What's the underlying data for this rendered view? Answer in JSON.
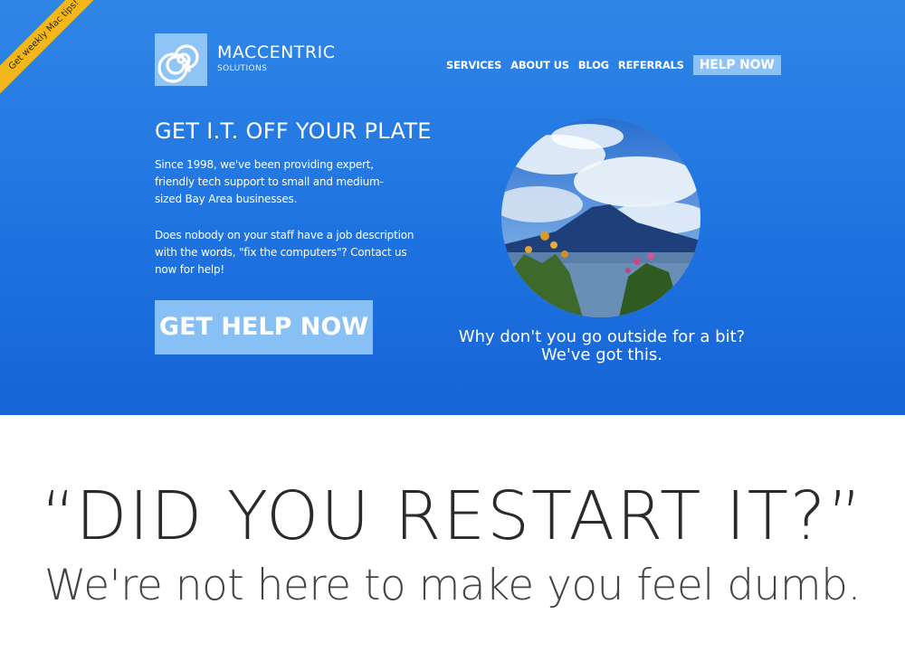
{
  "ribbon": {
    "label": "Get weekly Mac tips!"
  },
  "brand": {
    "name": "MACCENTRIC",
    "sub": "SOLUTIONS",
    "logo_icon": "spiral-icon",
    "logo_color": "#8fc4f6"
  },
  "nav": {
    "items": [
      {
        "label": "SERVICES"
      },
      {
        "label": "ABOUT US"
      },
      {
        "label": "BLOG"
      },
      {
        "label": "REFERRALS"
      },
      {
        "label": "HELP NOW"
      }
    ]
  },
  "hero": {
    "headline": "GET I.T. OFF YOUR PLATE",
    "paragraph1": "Since 1998, we've been providing expert, friendly tech support to small and medium-sized Bay Area businesses.",
    "paragraph2": "Does nobody on your staff have a job description with the words, \"fix the computers\"? Contact us now for help!",
    "cta_label": "GET HELP NOW",
    "caption_line1": "Why don't you go outside for a bit?",
    "caption_line2": "We've got this.",
    "background_color": "#1f73e1",
    "accent_color": "#88c0f5"
  },
  "quote": {
    "text": "“DID YOU RESTART IT?”",
    "tagline": "We're not here to make you feel dumb."
  }
}
